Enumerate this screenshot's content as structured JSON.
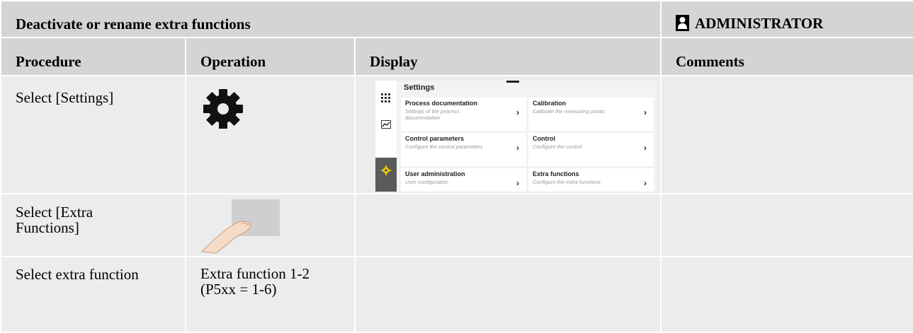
{
  "title": "Deactivate or rename extra functions",
  "role": "ADMINISTRATOR",
  "headers": {
    "procedure": "Procedure",
    "operation": "Operation",
    "display": "Display",
    "comments": "Comments"
  },
  "rows": [
    {
      "procedure": "Select [Settings]",
      "operation_icon": "gear-icon"
    },
    {
      "procedure_line1": "Select [Extra",
      "procedure_line2": "Functions]",
      "operation_icon": "finger-tap-icon"
    },
    {
      "procedure": "Select extra function",
      "operation_line1": "Extra function 1-2",
      "operation_line2": "(P5xx = 1-6)"
    }
  ],
  "screen": {
    "title": "Settings",
    "tiles": [
      {
        "title": "Process documentation",
        "subtitle": "Settings of the process documentation"
      },
      {
        "title": "Calibration",
        "subtitle": "Calibrate the measuring points"
      },
      {
        "title": "Control parameters",
        "subtitle": "Configure the control parameters"
      },
      {
        "title": "Control",
        "subtitle": "Configure the control"
      },
      {
        "title": "User administration",
        "subtitle": "User configuration"
      },
      {
        "title": "Extra functions",
        "subtitle": "Configure the extra functions"
      }
    ],
    "arrow": "›"
  },
  "colors": {
    "header_bg": "#d4d4d4",
    "cell_bg": "#ececec",
    "accent_gear": "#e6c800"
  }
}
